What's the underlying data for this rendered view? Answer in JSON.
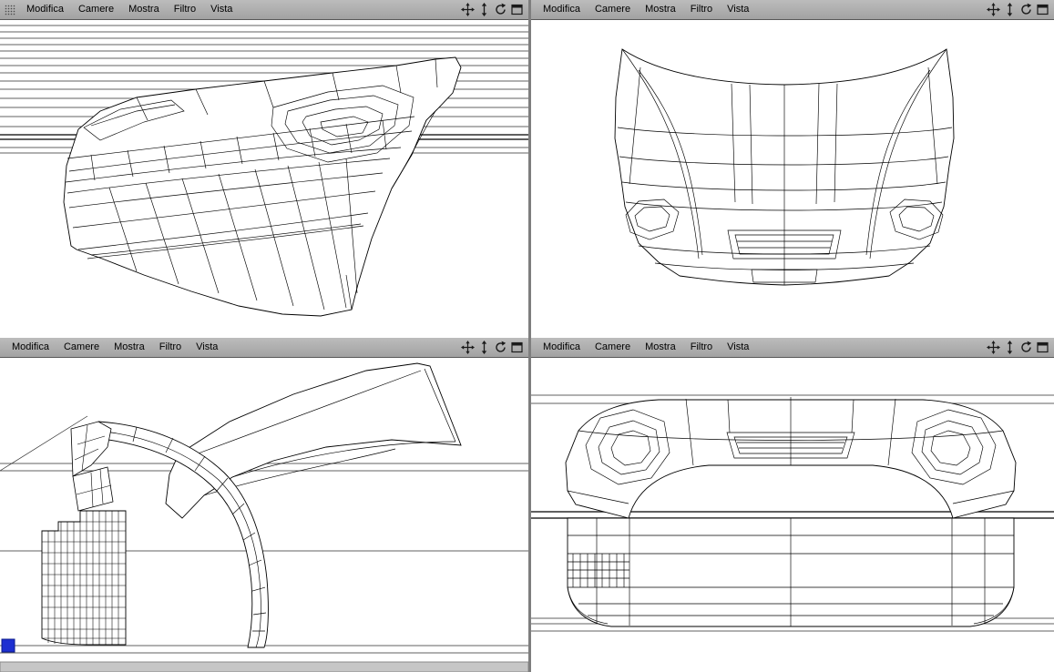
{
  "menu_items": [
    "Modifica",
    "Camere",
    "Mostra",
    "Filtro",
    "Vista"
  ],
  "colors": {
    "menubar_top": "#bcbcbc",
    "menubar_bottom": "#a2a2a2",
    "menubar_border": "#585858",
    "canvas_bg": "#ffffff",
    "wireframe": "#000000",
    "window_gap": "#7e7e7e",
    "object_swatch_blue": "#1d2fd1"
  },
  "viewport_controls": {
    "pan": "pan-icon",
    "zoom": "zoom-icon",
    "rotate": "rotate-icon",
    "maximize": "maximize-icon",
    "grid_handle": "grid-handle-icon"
  }
}
